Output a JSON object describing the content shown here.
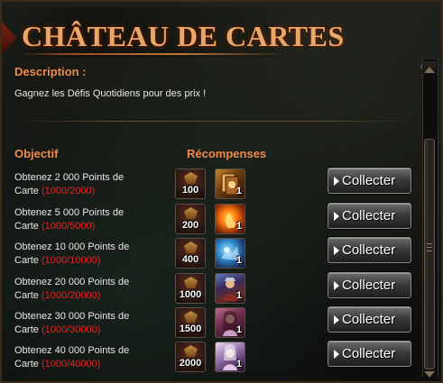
{
  "window": {
    "title": "CHÂTEAU DE CARTES"
  },
  "description": {
    "label": "Description :",
    "text": "Gagnez les Défis Quotidiens pour des prix !"
  },
  "columns": {
    "objective": "Objectif",
    "rewards": "Récompenses"
  },
  "rows": [
    {
      "line1": "Obtenez 2 000 Points de",
      "line2_prefix": "Carte ",
      "progress": "(1000/2000)",
      "points": "100",
      "item_icon": "card-pack-icon",
      "item_qty": "1",
      "button": "Collecter"
    },
    {
      "line1": "Obtenez 5 000 Points de",
      "line2_prefix": "Carte ",
      "progress": "(1000/5000)",
      "points": "200",
      "item_icon": "fire-card-icon",
      "item_qty": "1",
      "button": "Collecter"
    },
    {
      "line1": "Obtenez 10 000 Points de",
      "line2_prefix": "Carte ",
      "progress": "(1000/10000)",
      "points": "400",
      "item_icon": "frost-card-icon",
      "item_qty": "1",
      "button": "Collecter"
    },
    {
      "line1": "Obtenez 20 000 Points de",
      "line2_prefix": "Carte ",
      "progress": "(1000/20000)",
      "points": "1000",
      "item_icon": "warrior-card-icon",
      "item_qty": "1",
      "button": "Collecter"
    },
    {
      "line1": "Obtenez 30 000 Points de",
      "line2_prefix": "Carte ",
      "progress": "(1000/30000)",
      "points": "1500",
      "item_icon": "sorceress-card-icon",
      "item_qty": "1",
      "button": "Collecter"
    },
    {
      "line1": "Obtenez 40 000 Points de",
      "line2_prefix": "Carte ",
      "progress": "(1000/40000)",
      "points": "2000",
      "item_icon": "angel-card-icon",
      "item_qty": "1",
      "button": "Collecter"
    }
  ],
  "colors": {
    "heading": "#f08a4b",
    "title": "#e9a86a",
    "progress": "#e02626"
  }
}
